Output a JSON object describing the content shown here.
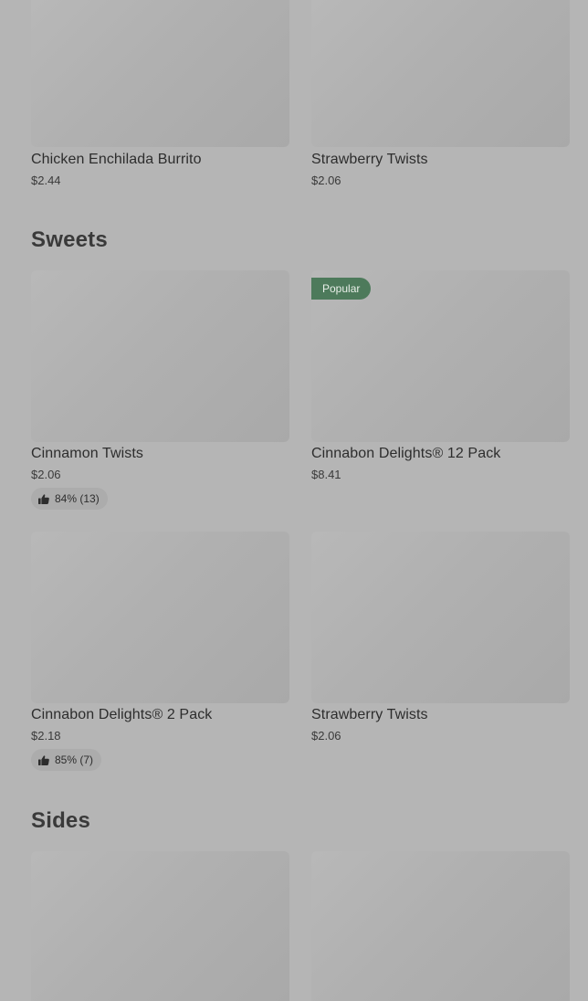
{
  "top_row": [
    {
      "name": "Chicken Enchilada Burrito",
      "price": "$2.44"
    },
    {
      "name": "Strawberry Twists",
      "price": "$2.06"
    }
  ],
  "sweets": {
    "heading": "Sweets",
    "items": [
      {
        "name": "Cinnamon Twists",
        "price": "$2.06",
        "rating": "84% (13)"
      },
      {
        "name": "Cinnabon Delights® 12 Pack",
        "price": "$8.41",
        "badge": "Popular"
      },
      {
        "name": "Cinnabon Delights® 2 Pack",
        "price": "$2.18",
        "rating": "85% (7)"
      },
      {
        "name": "Strawberry Twists",
        "price": "$2.06"
      }
    ]
  },
  "sides": {
    "heading": "Sides"
  },
  "icons": {
    "rating": "thumbs-up-icon"
  },
  "colors": {
    "background": "#b5b5b5",
    "badge": "#4d7a5b"
  }
}
